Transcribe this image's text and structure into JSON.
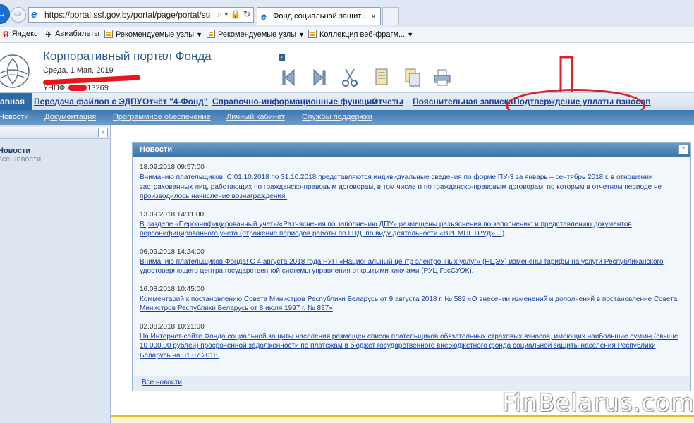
{
  "browser": {
    "url": "https://portal.ssf.gov.by/portal/page/portal/startp",
    "address_icons": "⌕ ▾ 🔒 ↻",
    "active_tab": {
      "title": "Фонд социальной защит...",
      "close": "×"
    }
  },
  "favorites": [
    {
      "label": "Яндекс",
      "icon": "yandex-icon"
    },
    {
      "label": "Авиабилеты",
      "icon": "plane-icon"
    },
    {
      "label": "Рекомендуемые узлы",
      "icon": "page-icon",
      "dropdown": true
    },
    {
      "label": "Рекомендуемые узлы",
      "icon": "page-icon",
      "dropdown": true
    },
    {
      "label": "Коллекция веб-фрагм...",
      "icon": "page-icon",
      "dropdown": true
    }
  ],
  "portal": {
    "title": "Корпоративный портал Фонда",
    "date": "Среда, 1 Мая, 2019",
    "unp_label": "УНПФ:",
    "unp_tail": "13269"
  },
  "main_menu": [
    {
      "label": "авная",
      "active": true
    },
    {
      "label": "Передача файлов с ЭДПУ"
    },
    {
      "label": "Отчёт \"4-Фонд\""
    },
    {
      "label": "Справочно-информационные функции"
    },
    {
      "label": "Отчеты"
    },
    {
      "label": "Пояснительная записка"
    },
    {
      "label": "Подтверждение уплаты взносов"
    }
  ],
  "sub_menu": [
    {
      "label": "Новости",
      "active": true
    },
    {
      "label": "Документация"
    },
    {
      "label": "Программное обеспечение"
    },
    {
      "label": "Личный кабинет"
    },
    {
      "label": "Службы поддержки"
    }
  ],
  "left_panel": {
    "collapse": "«",
    "news_title": "Новости",
    "all_news": "все новости"
  },
  "news": {
    "title": "Новости",
    "collapse": "«",
    "items": [
      {
        "date": "18.09.2018 09:57:00",
        "text": "Вниманию плательщиков! С 01.10.2018 по 31.10.2018 представляются индивидуальные сведения по форме ПУ-3 за январь – сентябрь 2018 г. в отношении застрахованных лиц, работающих по гражданско-правовым договорам, в том числе и по гражданско-правовым договорам, по которым в отчетном периоде не производилось начисление вознаграждения."
      },
      {
        "date": "13.09.2018 14:11:00",
        "text": "В разделе «Персонифицированный учет»/«Разъяснения по заполнению ДПУ» размещены разъяснения по заполнению и представлению документов персонифицированного учета (отражение периодов работы по ГПД, по виду деятельности «ВРЕМНЕТРУД»…)"
      },
      {
        "date": "06.09.2018 14:24:00",
        "text": "Вниманию плательщиков Фонда! С 4 августа 2018 года РУП «Национальный центр электронных услуг» (НЦЭУ) изменены тарифы на услуги Республиканского удостоверяющего центра государственной системы управления открытыми ключами (РУЦ ГосСУОК)."
      },
      {
        "date": "16.08.2018 10:45:00",
        "text": "Комментарий к постановлению Совета Министров Республики Беларусь от 9 августа 2018 г. № 589 «О внесении изменений и дополнений в постановление Совета Министров Республики Беларусь от 8 июля 1997 г. № 837»"
      },
      {
        "date": "02.08.2018 10:21:00",
        "text": "На Интернет-сайте Фонда социальной защиты населения размещен список плательщиков обязательных страховых взносов, имеющих наибольшие суммы (свыше 10 000,00 рублей) просроченной задолженности по платежам в бюджет государственного внебюджетного фонда социальной защиты населения Республики Беларусь на 01.07.2018."
      }
    ],
    "all_news": "Все новости"
  },
  "watermark": "FinBelarus.com",
  "colors": {
    "accent": "#2f6aa8",
    "link": "#1a3f9a",
    "annotation": "#d8222a"
  }
}
